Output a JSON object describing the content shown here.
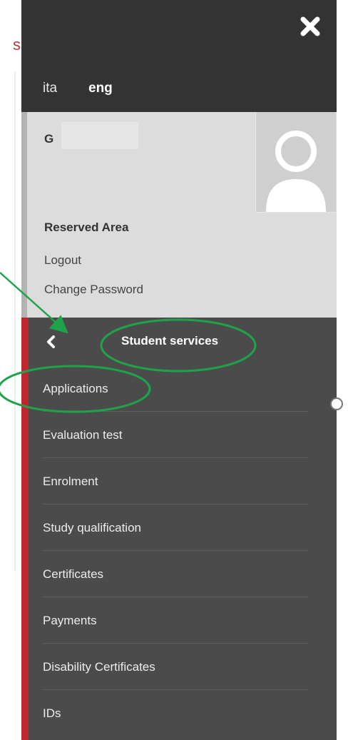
{
  "topbar": {
    "close_icon": "close-icon",
    "languages": {
      "ita": "ita",
      "eng": "eng"
    }
  },
  "user": {
    "name_initial": "G",
    "avatar_icon": "user-avatar-icon",
    "reserved_area": "Reserved Area",
    "logout": "Logout",
    "change_password": "Change Password"
  },
  "nav": {
    "back_icon": "chevron-left-icon",
    "title": "Student services",
    "items": [
      {
        "label": "Applications"
      },
      {
        "label": "Evaluation test"
      },
      {
        "label": "Enrolment"
      },
      {
        "label": "Study qualification"
      },
      {
        "label": "Certificates"
      },
      {
        "label": "Payments"
      },
      {
        "label": "Disability Certificates"
      },
      {
        "label": "IDs"
      }
    ]
  },
  "colors": {
    "topbar_bg": "#333333",
    "user_panel_bg": "#dcdcdc",
    "nav_bg": "#4b4b4b",
    "accent_red": "#c0262f",
    "annotation_green": "#1fa34a"
  },
  "annotations": {
    "arrow": "arrow-icon",
    "highlight_shapes": [
      "oval-around-title",
      "oval-around-applications"
    ]
  }
}
